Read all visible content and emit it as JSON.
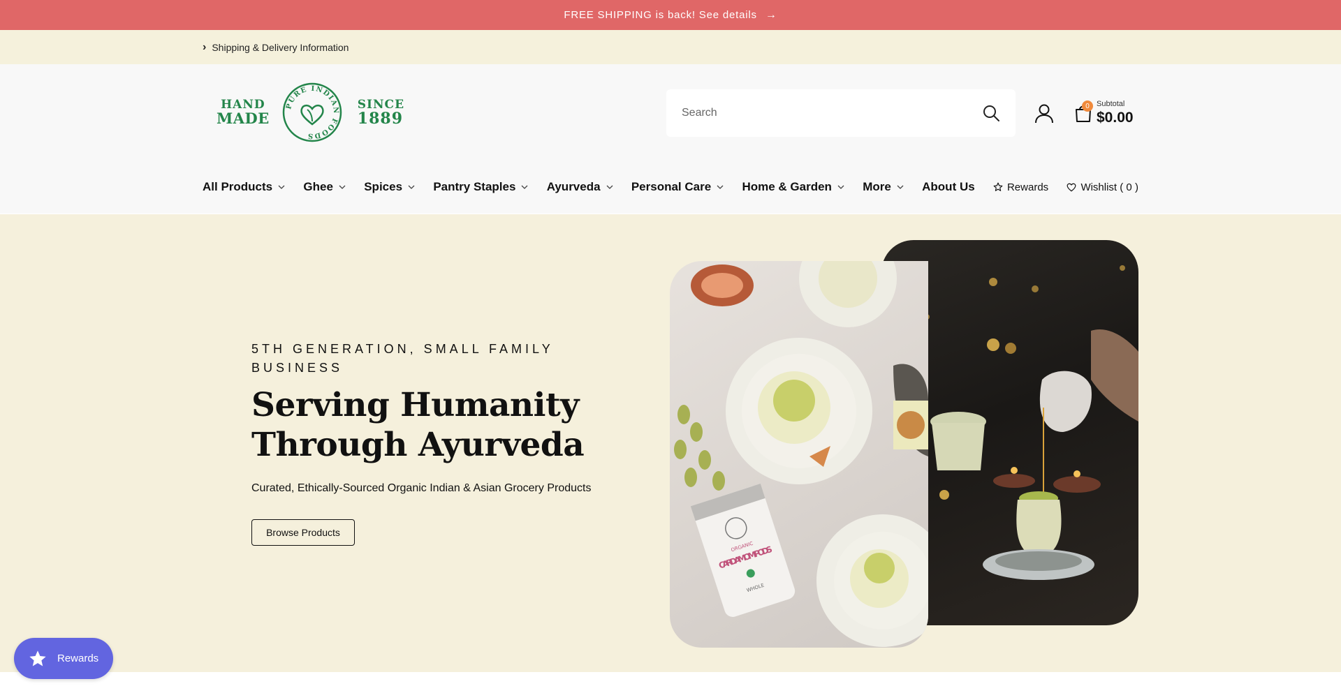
{
  "announcement": {
    "text": "FREE SHIPPING is back! See details",
    "arrow": "→"
  },
  "infobar": {
    "label": "Shipping & Delivery Information"
  },
  "logo": {
    "left_top": "HAND",
    "left_bottom": "MADE",
    "ring_text": "PURE INDIAN FOODS",
    "right_top": "SINCE",
    "right_bottom": "1889",
    "color": "#23854a"
  },
  "search": {
    "placeholder": "Search",
    "icon": "search-icon"
  },
  "cart": {
    "count": "0",
    "subtotal_label": "Subtotal",
    "subtotal_amount": "$0.00",
    "badge_color": "#f08a3c"
  },
  "nav": {
    "items": [
      {
        "label": "All Products",
        "has_dropdown": true
      },
      {
        "label": "Ghee",
        "has_dropdown": true
      },
      {
        "label": "Spices",
        "has_dropdown": true
      },
      {
        "label": "Pantry Staples",
        "has_dropdown": true
      },
      {
        "label": "Ayurveda",
        "has_dropdown": true
      },
      {
        "label": "Personal Care",
        "has_dropdown": true
      },
      {
        "label": "Home & Garden",
        "has_dropdown": true
      },
      {
        "label": "More",
        "has_dropdown": true
      },
      {
        "label": "About Us",
        "has_dropdown": false
      }
    ],
    "rewards_label": "Rewards",
    "wishlist_label": "Wishlist ( 0 )"
  },
  "hero": {
    "eyebrow": "5TH GENERATION, SMALL FAMILY BUSINESS",
    "title": "Serving Humanity Through Ayurveda",
    "subtitle": "Curated, Ethically-Sourced Organic Indian & Asian Grocery Products",
    "button_label": "Browse Products",
    "jar_text_top": "ORGANIC",
    "jar_text_main": "CARDAMOM PODS",
    "jar_text_bottom": "WHOLE"
  },
  "floating_rewards": {
    "label": "Rewards",
    "color": "#6265e0"
  },
  "colors": {
    "announcement_bg": "#e06767",
    "cream": "#f5f0dc",
    "header_bg": "#f8f8f8"
  }
}
